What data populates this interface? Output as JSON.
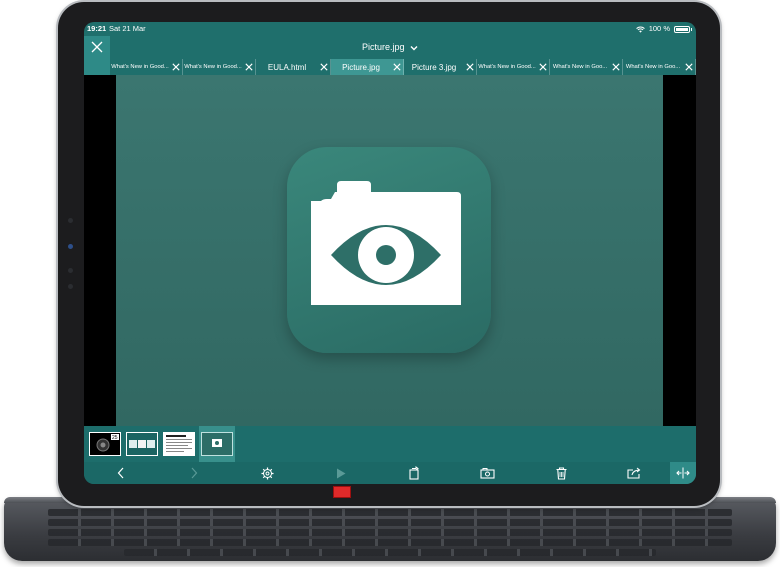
{
  "status": {
    "time": "19:21",
    "date": "Sat 21 Mar",
    "battery": "100 %",
    "battery_level": 1.0
  },
  "title": {
    "text": "Picture.jpg"
  },
  "tabs": [
    {
      "label": "What's New in Good...",
      "size": "small",
      "active": false
    },
    {
      "label": "What's New in Good...",
      "size": "small",
      "active": false
    },
    {
      "label": "EULA.html",
      "size": "big",
      "active": false
    },
    {
      "label": "Picture.jpg",
      "size": "big",
      "active": true
    },
    {
      "label": "Picture 3.jpg",
      "size": "big",
      "active": false
    },
    {
      "label": "What's New in Good...",
      "size": "small",
      "active": false
    },
    {
      "label": "What's New in Goo...",
      "size": "small",
      "active": false
    },
    {
      "label": "What's New in Goo...",
      "size": "small",
      "active": false
    }
  ],
  "thumbnails": [
    {
      "name": "thumbnail-camera",
      "badge": "25"
    },
    {
      "name": "thumbnail-photos"
    },
    {
      "name": "thumbnail-document"
    },
    {
      "name": "thumbnail-picture",
      "active": true
    }
  ],
  "toolbar": {
    "back": "chevron-left-icon",
    "forward": "chevron-right-icon",
    "settings": "gear-icon",
    "play": "play-icon",
    "rotate": "rotate-page-icon",
    "photos": "photo-library-icon",
    "delete": "trash-icon",
    "share": "share-icon",
    "fullscreen": "expand-icon"
  },
  "colors": {
    "accent": "#1f6f6c",
    "active_tab": "#3e9793",
    "image_bg": "#356e68"
  }
}
